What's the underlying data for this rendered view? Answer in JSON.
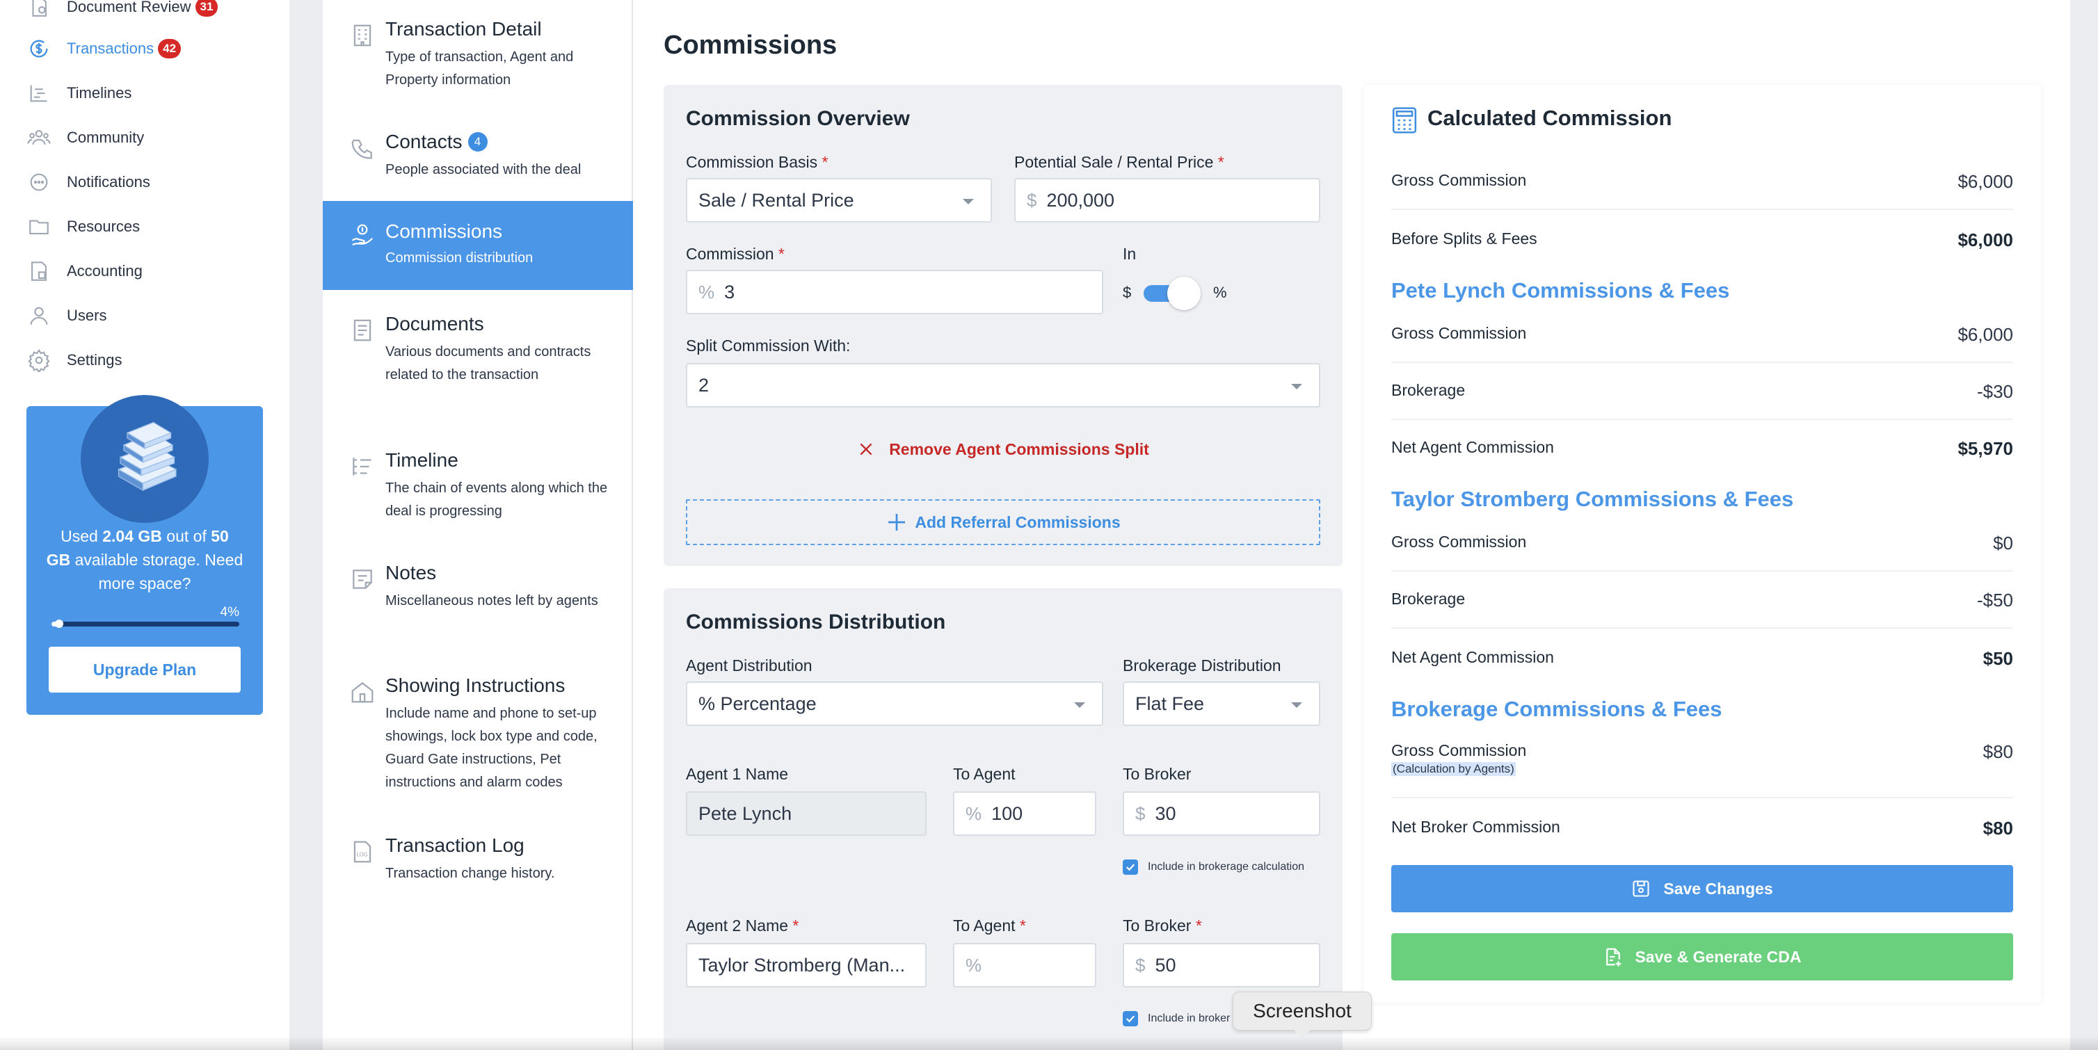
{
  "nav": {
    "items": [
      {
        "label": "Document Review",
        "badge": "31",
        "icon": "document-review-icon"
      },
      {
        "label": "Transactions",
        "badge": "42",
        "icon": "dollar-circle-icon",
        "active": true
      },
      {
        "label": "Timelines",
        "icon": "timeline-icon"
      },
      {
        "label": "Community",
        "icon": "community-icon"
      },
      {
        "label": "Notifications",
        "icon": "chat-bubble-icon"
      },
      {
        "label": "Resources",
        "icon": "folder-icon"
      },
      {
        "label": "Accounting",
        "icon": "accounting-icon"
      },
      {
        "label": "Users",
        "icon": "user-icon"
      },
      {
        "label": "Settings",
        "icon": "gear-icon"
      }
    ],
    "storage": {
      "used": "2.04 GB",
      "total": "50",
      "text_prefix": "Used ",
      "text_mid": " out of ",
      "text_suffix": "GB",
      "text_available": " available storage. Need more space?",
      "percent_label": "4%",
      "percent_value": 0.04,
      "upgrade_label": "Upgrade Plan"
    }
  },
  "sections": [
    {
      "title": "Transaction Detail",
      "desc": "Type of transaction, Agent and Property information",
      "icon": "building-icon"
    },
    {
      "title": "Contacts",
      "badge": "4",
      "desc": "People associated with the deal",
      "icon": "phone-icon"
    },
    {
      "title": "Commissions",
      "desc": "Commission distribution",
      "icon": "money-hand-icon",
      "active": true
    },
    {
      "title": "Documents",
      "desc": "Various documents and contracts related to the transaction",
      "icon": "document-icon"
    },
    {
      "title": "Timeline",
      "desc": "The chain of events along which the deal is progressing",
      "icon": "timeline-icon"
    },
    {
      "title": "Notes",
      "desc": "Miscellaneous notes left by agents",
      "icon": "note-icon"
    },
    {
      "title": "Showing Instructions",
      "desc": "Include name and phone to set-up showings, lock box type and code, Guard Gate instructions, Pet instructions and alarm codes",
      "icon": "house-icon"
    },
    {
      "title": "Transaction Log",
      "desc": "Transaction change history.",
      "icon": "log-icon"
    }
  ],
  "main": {
    "title": "Commissions",
    "overview": {
      "title": "Commission Overview",
      "basis_label": "Commission Basis",
      "basis_value": "Sale / Rental Price",
      "price_label": "Potential Sale / Rental Price",
      "price_prefix": "$",
      "price_value": "200,000",
      "commission_label": "Commission",
      "commission_prefix": "%",
      "commission_value": "3",
      "in_label": "In",
      "toggle_left": "$",
      "toggle_right": "%",
      "split_label": "Split Commission With:",
      "split_value": "2",
      "remove_split_label": "Remove Agent Commissions Split",
      "add_referral_label": "Add Referral Commissions"
    },
    "distribution": {
      "title": "Commissions Distribution",
      "agent_dist_label": "Agent Distribution",
      "agent_dist_value": "% Percentage",
      "brokerage_dist_label": "Brokerage Distribution",
      "brokerage_dist_value": "Flat Fee",
      "agent1_name_label": "Agent 1 Name",
      "agent1_name_value": "Pete Lynch",
      "agent1_to_agent_label": "To Agent",
      "agent1_to_agent_prefix": "%",
      "agent1_to_agent_value": "100",
      "agent1_to_broker_label": "To Broker",
      "agent1_to_broker_prefix": "$",
      "agent1_to_broker_value": "30",
      "include_label": "Include in brokerage calculation",
      "include_label_cut": "Include in broker",
      "agent2_name_label": "Agent 2 Name",
      "agent2_name_value": "Taylor Stromberg (Man...",
      "agent2_to_agent_label": "To Agent",
      "agent2_to_agent_prefix": "%",
      "agent2_to_broker_label": "To Broker",
      "agent2_to_broker_prefix": "$",
      "agent2_to_broker_value": "50"
    }
  },
  "calc": {
    "title": "Calculated Commission",
    "gross_label": "Gross Commission",
    "gross_value": "$6,000",
    "before_label": "Before Splits & Fees",
    "before_value": "$6,000",
    "agent1": {
      "heading": "Pete Lynch Commissions & Fees",
      "gross_label": "Gross Commission",
      "gross_value": "$6,000",
      "brokerage_label": "Brokerage",
      "brokerage_value": "-$30",
      "net_label": "Net Agent Commission",
      "net_value": "$5,970"
    },
    "agent2": {
      "heading": "Taylor Stromberg Commissions & Fees",
      "gross_label": "Gross Commission",
      "gross_value": "$0",
      "brokerage_label": "Brokerage",
      "brokerage_value": "-$50",
      "net_label": "Net Agent Commission",
      "net_value": "$50"
    },
    "brokerage": {
      "heading": "Brokerage Commissions & Fees",
      "gross_label": "Gross Commission",
      "gross_note": "(Calculation by Agents)",
      "gross_value": "$80",
      "net_label": "Net Broker Commission",
      "net_value": "$80"
    },
    "save_label": "Save Changes",
    "cda_label": "Save & Generate CDA"
  },
  "tooltip": "Screenshot",
  "colors": {
    "accent": "#4b96e6",
    "danger": "#d72828",
    "success": "#6ad07e"
  }
}
